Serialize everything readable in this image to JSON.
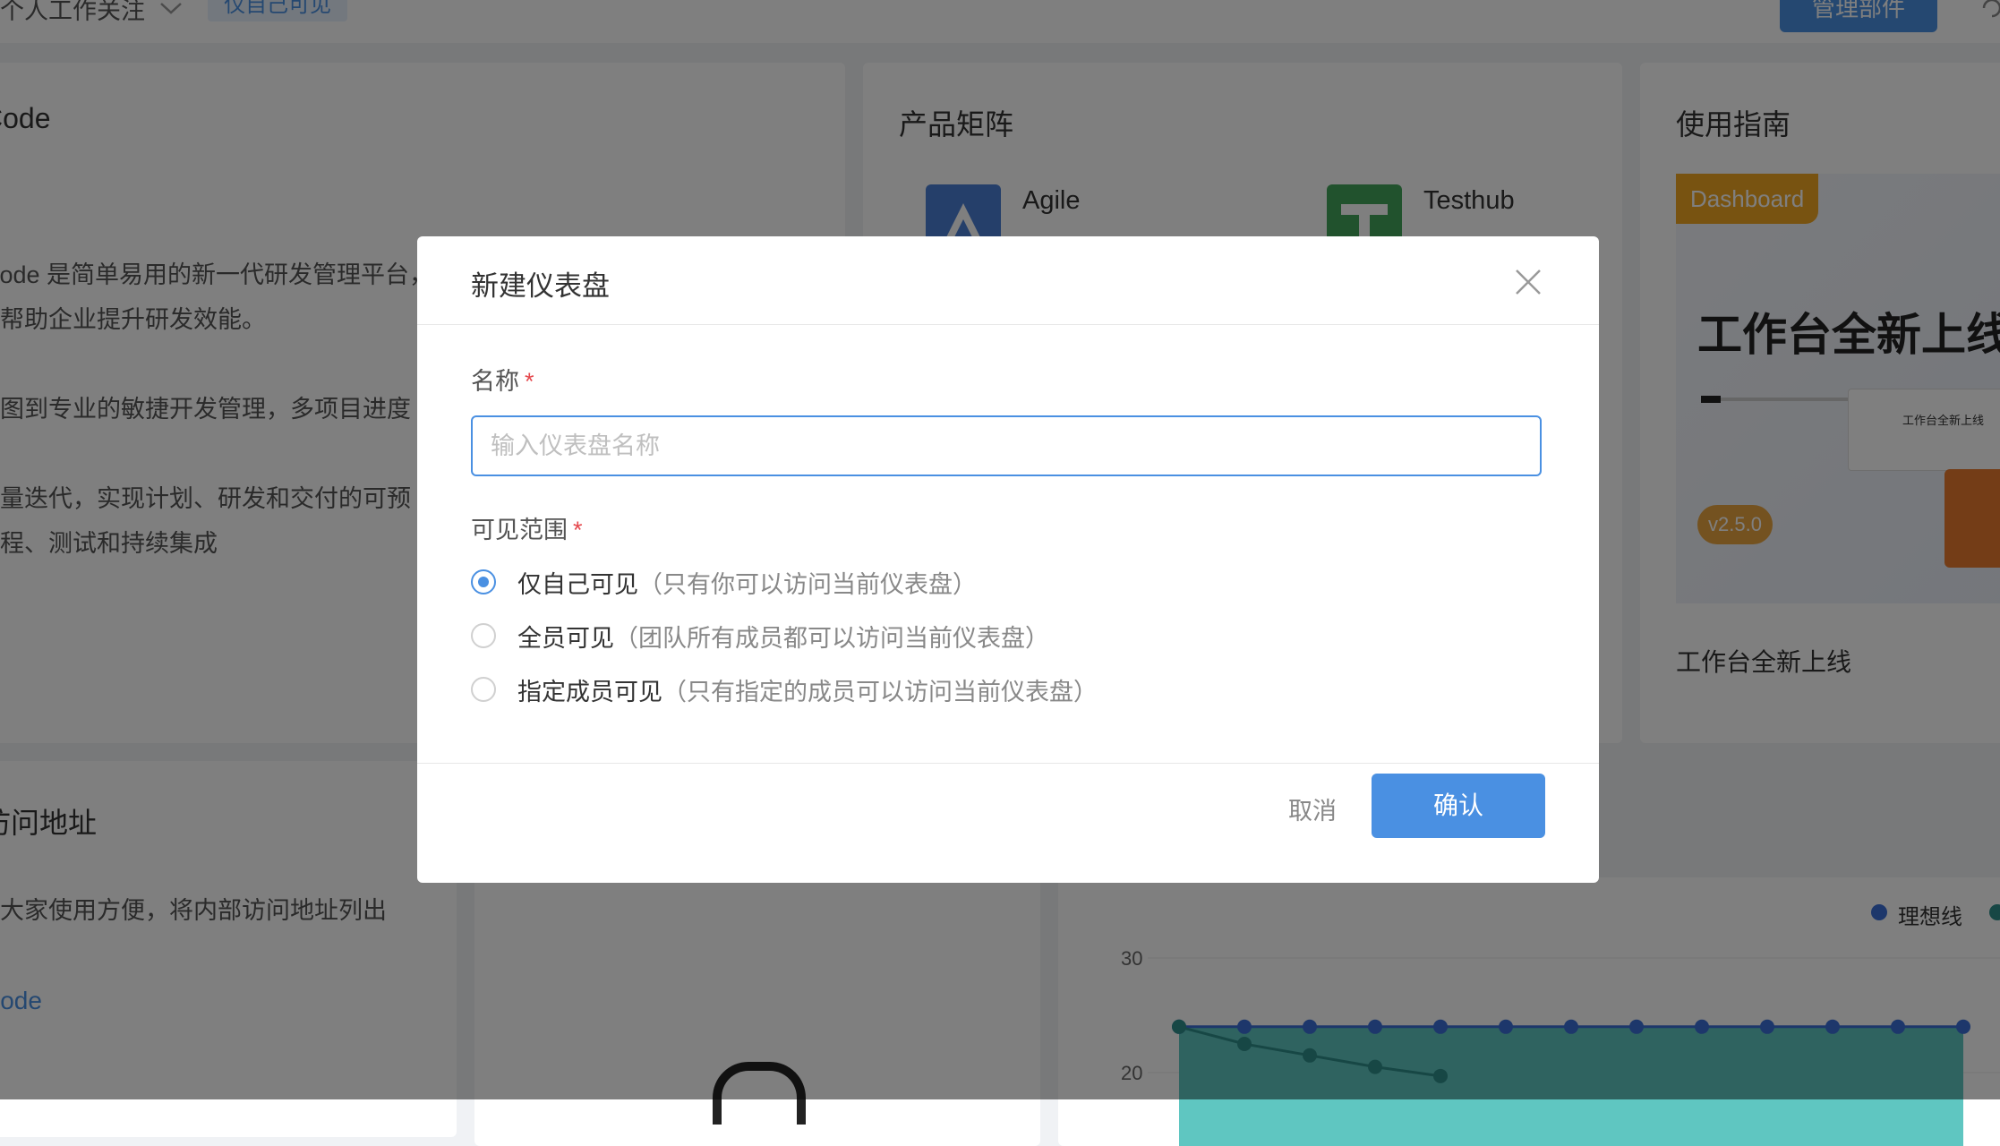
{
  "topbar": {
    "dropdown_label": "个人工作关注",
    "visibility_tag": "仅自己可见",
    "manage_button": "管理部件"
  },
  "intro_card": {
    "title": "Code",
    "lines": [
      "Code 是简单易用的新一代研发管理平台，让研发管理自动化、数据化、智",
      "帮助企业提升研发效能。",
      "图到专业的敏捷开发管理，多项目进度",
      "量迭代，实现计划、研发和交付的可预",
      "程、测试和持续集成"
    ]
  },
  "product_card": {
    "title": "产品矩阵",
    "products": [
      {
        "name": "Agile",
        "icon": "agile-logo-icon",
        "color": "#4a7fd4"
      },
      {
        "name": "Testhub",
        "icon": "testhub-logo-icon",
        "color": "#43a55a"
      }
    ]
  },
  "guide_card": {
    "title": "使用指南",
    "banner": {
      "tag": "Dashboard",
      "headline": "工作台全新上线",
      "version": "v2.5.0",
      "mini_text": "工作台全新上线"
    },
    "caption": "工作台全新上线"
  },
  "access_card": {
    "title": "访问地址",
    "desc": "大家使用方便，将内部访问地址列出",
    "link": "Code"
  },
  "burndown_card": {
    "legend": "理想线"
  },
  "chart_data": {
    "type": "line",
    "y_ticks": [
      30,
      20
    ],
    "series": [
      {
        "name": "理想线",
        "values": [
          24,
          24,
          24,
          24,
          24,
          24,
          24,
          24,
          24,
          24,
          24,
          24,
          24
        ],
        "color": "#3b6fd6"
      },
      {
        "values": [
          24,
          22.5,
          21.5,
          20.5,
          19.7
        ],
        "color": "#2f8e8a"
      }
    ]
  },
  "modal": {
    "title": "新建仪表盘",
    "name_label": "名称",
    "required_mark": "*",
    "name_placeholder": "输入仪表盘名称",
    "scope_label": "可见范围",
    "options": [
      {
        "label": "仅自己可见",
        "hint": "（只有你可以访问当前仪表盘）",
        "checked": true
      },
      {
        "label": "全员可见",
        "hint": "（团队所有成员都可以访问当前仪表盘）",
        "checked": false
      },
      {
        "label": "指定成员可见",
        "hint": "（只有指定的成员可以访问当前仪表盘）",
        "checked": false
      }
    ],
    "cancel_label": "取消",
    "confirm_label": "确认"
  },
  "colors": {
    "accent": "#4a90e2",
    "required": "#e5484d",
    "overlay": "rgba(0,0,0,0.5)"
  }
}
